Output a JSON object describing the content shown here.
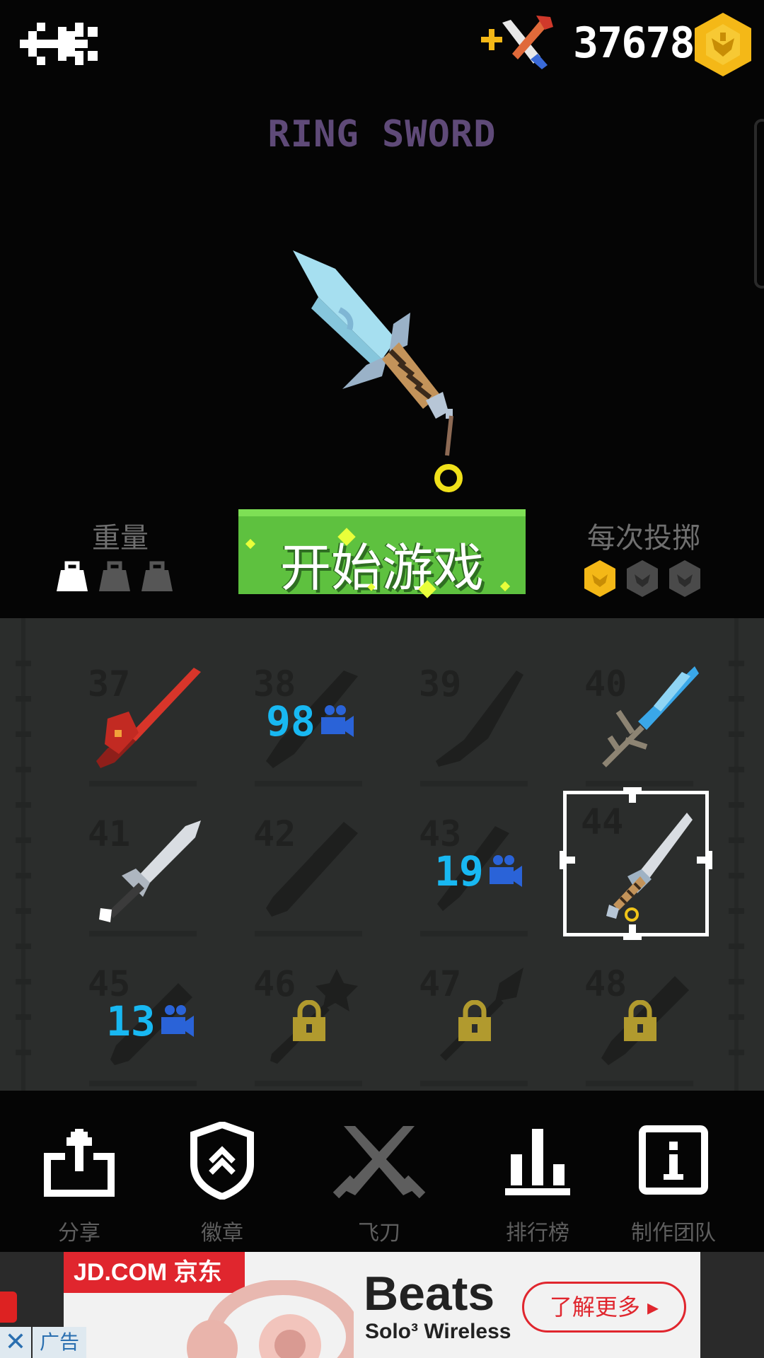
{
  "header": {
    "coin_count": "37678"
  },
  "weapon": {
    "name": "RING SWORD"
  },
  "stats": {
    "weight_label": "重量",
    "weight_level": 1,
    "weight_max": 3,
    "throw_label": "每次投掷",
    "throw_cost_level": 1,
    "throw_cost_max": 3
  },
  "start_button": {
    "label": "开始游戏"
  },
  "grid": {
    "items": [
      {
        "number": "37",
        "state": "owned",
        "weapon": "red-spiked-sword"
      },
      {
        "number": "38",
        "state": "video",
        "video_count": "98",
        "weapon": "dark-broad-sword"
      },
      {
        "number": "39",
        "state": "dim",
        "weapon": "dark-machete"
      },
      {
        "number": "40",
        "state": "owned",
        "weapon": "crystal-branch-sword"
      },
      {
        "number": "41",
        "state": "owned",
        "weapon": "silver-short-sword"
      },
      {
        "number": "42",
        "state": "dim",
        "weapon": "dark-gun-sword"
      },
      {
        "number": "43",
        "state": "video",
        "video_count": "19",
        "weapon": "dark-dagger"
      },
      {
        "number": "44",
        "state": "selected",
        "weapon": "ring-sword"
      },
      {
        "number": "45",
        "state": "video",
        "video_count": "13",
        "weapon": "dark-cleaver"
      },
      {
        "number": "46",
        "state": "locked",
        "weapon": "dark-star-mace"
      },
      {
        "number": "47",
        "state": "locked",
        "weapon": "dark-spear"
      },
      {
        "number": "48",
        "state": "locked",
        "weapon": "dark-chainsaw"
      }
    ]
  },
  "nav": {
    "share": "分享",
    "badges": "徽章",
    "knives": "飞刀",
    "leaderboard": "排行榜",
    "credits": "制作团队"
  },
  "ad": {
    "brand": "JD.COM 京东",
    "headline": "Beats",
    "subline": "Solo³ Wireless",
    "cta": "了解更多 ▸",
    "close": "✕",
    "tag": "广告"
  },
  "colors": {
    "title": "#5f4a78",
    "start_green": "#5ec13f",
    "video_blue": "#18b8f2",
    "lock_gold": "#b19a2e",
    "coin_gold": "#f4b817"
  }
}
